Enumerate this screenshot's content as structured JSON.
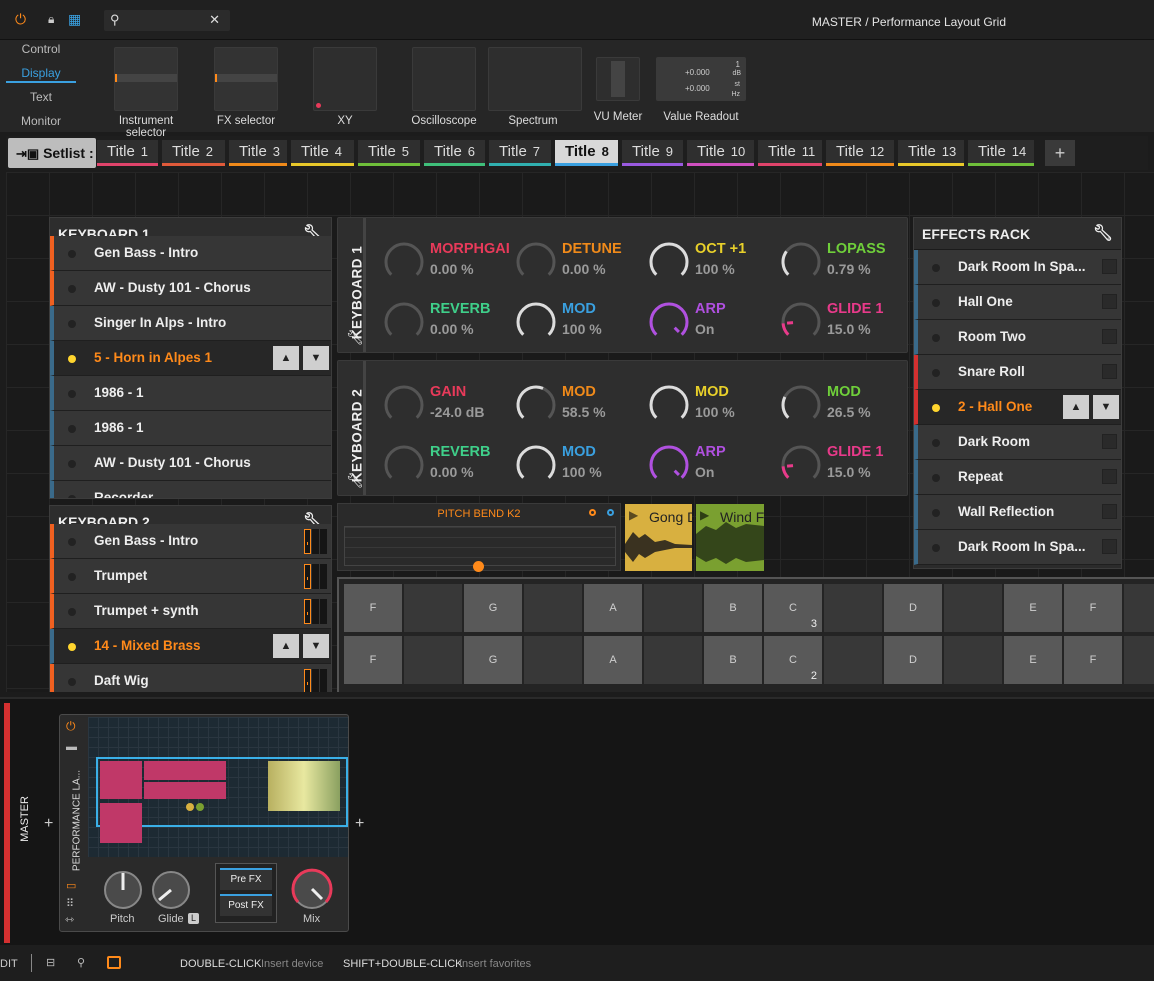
{
  "topbar": {
    "breadcrumb": "MASTER / Performance Layout Grid",
    "icons": [
      "power-icon",
      "lock-icon",
      "grid-icon",
      "search-icon",
      "close-icon"
    ]
  },
  "modes": [
    "Control",
    "Display",
    "Text",
    "Monitor"
  ],
  "palette": [
    {
      "label": "Instrument selector"
    },
    {
      "label": "FX selector"
    },
    {
      "label": "XY"
    },
    {
      "label": "Oscilloscope"
    },
    {
      "label": "Spectrum"
    },
    {
      "label": "VU Meter"
    },
    {
      "label": "Value Readout"
    }
  ],
  "value_readout": {
    "a": "+0.000",
    "b": "+0.000",
    "u1": "dB",
    "u2": "st",
    "u3": "Hz",
    "one": "1"
  },
  "setlist": {
    "label": "Setlist :",
    "tabs": [
      {
        "t": "Title",
        "n": "1",
        "c": "#e0446b"
      },
      {
        "t": "Title",
        "n": "2",
        "c": "#e05a3a"
      },
      {
        "t": "Title",
        "n": "3",
        "c": "#f08a1a"
      },
      {
        "t": "Title",
        "n": "4",
        "c": "#e8c82a"
      },
      {
        "t": "Title",
        "n": "5",
        "c": "#6fbf3a"
      },
      {
        "t": "Title",
        "n": "6",
        "c": "#3fbf7a"
      },
      {
        "t": "Title",
        "n": "7",
        "c": "#30b0b0"
      },
      {
        "t": "Title",
        "n": "8",
        "c": "#3aa0e0"
      },
      {
        "t": "Title",
        "n": "9",
        "c": "#9a5ae0"
      },
      {
        "t": "Title",
        "n": "10",
        "c": "#d050c0"
      },
      {
        "t": "Title",
        "n": "11",
        "c": "#e0446b"
      },
      {
        "t": "Title",
        "n": "12",
        "c": "#f08a1a"
      },
      {
        "t": "Title",
        "n": "13",
        "c": "#e8c82a"
      },
      {
        "t": "Title",
        "n": "14",
        "c": "#6fbf3a"
      }
    ],
    "add": "+"
  },
  "kb1": {
    "title": "KEYBOARD 1",
    "items": [
      "Gen Bass - Intro",
      "AW - Dusty 101 - Chorus",
      "Singer In Alps - Intro",
      "5 - Horn in Alpes 1",
      "1986 - 1",
      "1986 - 1",
      "AW - Dusty 101 - Chorus",
      "Recorder"
    ]
  },
  "kb2": {
    "title": "KEYBOARD 2",
    "items": [
      "Gen Bass - Intro",
      "Trumpet",
      "Trumpet + synth",
      "14 - Mixed Brass",
      "Daft Wig"
    ]
  },
  "fx": {
    "title": "EFFECTS RACK",
    "items": [
      "Dark Room In Spa...",
      "Hall One",
      "Room Two",
      "Snare Roll",
      "2 - Hall One",
      "Dark Room",
      "Repeat",
      "Wall Reflection",
      "Dark Room In Spa..."
    ]
  },
  "macros1": {
    "label": "KEYBOARD 1",
    "knobs": [
      {
        "n": "MORPHGAI",
        "v": "0.00 %",
        "c": "#e83a5a",
        "f": 0
      },
      {
        "n": "DETUNE",
        "v": "0.00 %",
        "c": "#f08a1a",
        "f": 0
      },
      {
        "n": "OCT +1",
        "v": "100 %",
        "c": "#e8d02a",
        "f": 1
      },
      {
        "n": "LOPASS",
        "v": "0.79 %",
        "c": "#6fcf3a",
        "f": 0.3
      },
      {
        "n": "REVERB",
        "v": "0.00 %",
        "c": "#3fcf8a",
        "f": 0
      },
      {
        "n": "MOD",
        "v": "100 %",
        "c": "#3aa0e0",
        "f": 1
      },
      {
        "n": "ARP",
        "v": "On",
        "c": "#b050e0",
        "f": 1
      },
      {
        "n": "GLIDE 1",
        "v": "15.0 %",
        "c": "#e83a8a",
        "f": 0.15
      }
    ]
  },
  "macros2": {
    "label": "KEYBOARD 2",
    "knobs": [
      {
        "n": "GAIN",
        "v": "-24.0 dB",
        "c": "#e83a5a",
        "f": 0
      },
      {
        "n": "MOD",
        "v": "58.5 %",
        "c": "#f08a1a",
        "f": 0.585
      },
      {
        "n": "MOD",
        "v": "100 %",
        "c": "#e8d02a",
        "f": 1
      },
      {
        "n": "MOD",
        "v": "26.5 %",
        "c": "#6fcf3a",
        "f": 0.265
      },
      {
        "n": "REVERB",
        "v": "0.00 %",
        "c": "#3fcf8a",
        "f": 0
      },
      {
        "n": "MOD",
        "v": "100 %",
        "c": "#3aa0e0",
        "f": 1
      },
      {
        "n": "ARP",
        "v": "On",
        "c": "#b050e0",
        "f": 1
      },
      {
        "n": "GLIDE 1",
        "v": "15.0 %",
        "c": "#e83a8a",
        "f": 0.15
      }
    ]
  },
  "pitchbend": {
    "label": "PITCH BEND K2"
  },
  "clips": [
    {
      "t": "Gong D",
      "c": "#d8b040"
    },
    {
      "t": "Wind F",
      "c": "#7aa030"
    }
  ],
  "pads": {
    "row1": [
      "F",
      "",
      "G",
      "",
      "A",
      "",
      "B",
      "C",
      "",
      "D",
      "",
      "E",
      "F",
      ""
    ],
    "row2": [
      "F",
      "",
      "G",
      "",
      "A",
      "",
      "B",
      "C",
      "",
      "D",
      "",
      "E",
      "F",
      ""
    ],
    "sub1": "3",
    "sub2": "2"
  },
  "device": {
    "track": "MASTER",
    "name": "PERFORMANCE LA...",
    "pitch": "Pitch",
    "glide": "Glide",
    "glide_badge": "L",
    "prefx": "Pre FX",
    "postfx": "Post FX",
    "mix": "Mix",
    "plus": "+"
  },
  "status": {
    "left": "DIT",
    "hint1_key": "DOUBLE-CLICK",
    "hint1": "Insert device",
    "hint2_key": "SHIFT+DOUBLE-CLICK",
    "hint2": "Insert favorites"
  }
}
